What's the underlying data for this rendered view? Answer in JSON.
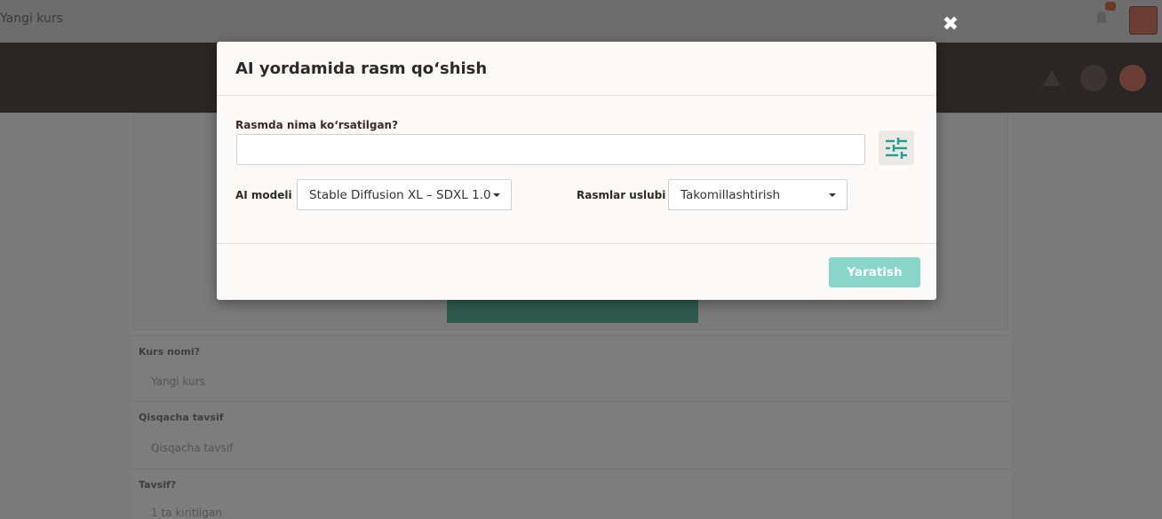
{
  "background": {
    "topbar_title": "Yangi kurs",
    "field1_label": "Kurs nomi?",
    "field1_value": "Yangi kurs",
    "field2_label": "Qisqacha tavsif",
    "field2_value": "Qisqacha tavsif",
    "field3_label": "Tavsif?",
    "field3_value": "1 ta kiritilgan"
  },
  "modal": {
    "close_glyph": "✖",
    "title": "AI yordamida rasm qo‘shish",
    "prompt_label": "Rasmda nima ko‘rsatilgan?",
    "prompt_value": "",
    "settings_icon": "sliders-icon",
    "model_label": "AI modeli",
    "model_value": "Stable Diffusion XL – SDXL 1.0",
    "style_label": "Rasmlar uslubi",
    "style_value": "Takomillashtirish",
    "submit_label": "Yaratish"
  },
  "colors": {
    "accent": "#1aa390",
    "submit_disabled": "#88d6c9",
    "overlay": "#7a7a7a"
  }
}
